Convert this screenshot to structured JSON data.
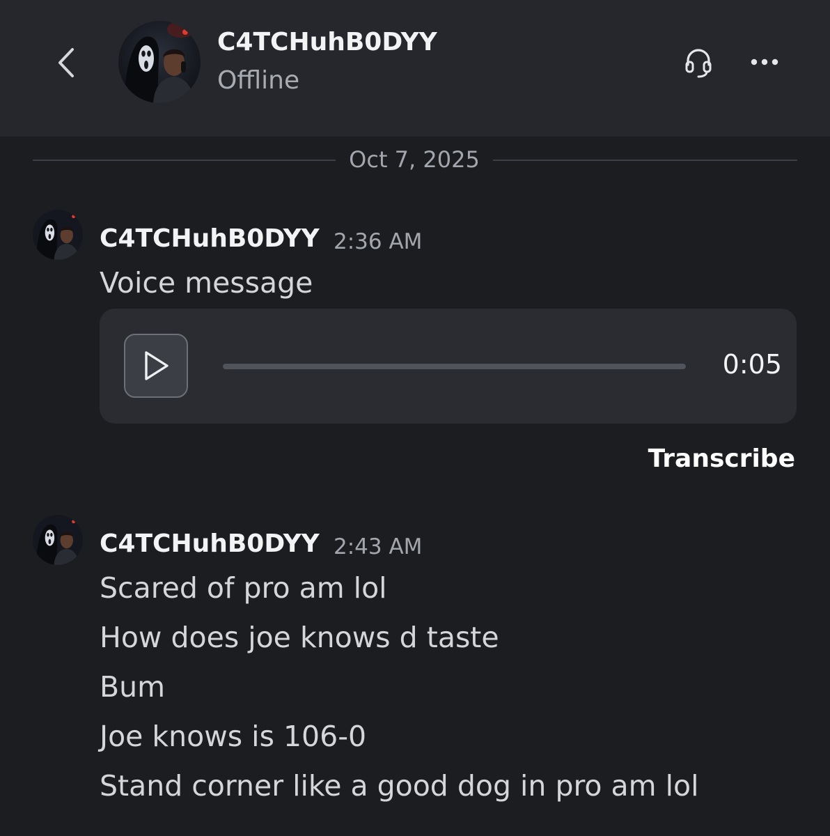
{
  "header": {
    "back_icon": "chevron-left-icon",
    "name": "C4TCHuhB0DYY",
    "status": "Offline",
    "headset_icon": "headset-icon",
    "more_icon": "more-horizontal-icon"
  },
  "date_divider": "Oct 7, 2025",
  "messages": [
    {
      "author": "C4TCHuhB0DYY",
      "time": "2:36 AM",
      "lines": [
        "Voice message"
      ],
      "voice": {
        "play_icon": "play-icon",
        "duration": "0:05",
        "progress": 0,
        "transcribe_label": "Transcribe"
      }
    },
    {
      "author": "C4TCHuhB0DYY",
      "time": "2:43 AM",
      "lines": [
        "Scared of pro am lol",
        "How does joe knows d taste",
        "Bum",
        "Joe knows is 106-0",
        "Stand corner like a good dog in pro am lol"
      ]
    }
  ],
  "colors": {
    "background": "#1c1d21",
    "header": "#26272c",
    "card": "#2b2c31",
    "muted_text": "#a3a6ad",
    "message_text": "#d4d6da"
  }
}
